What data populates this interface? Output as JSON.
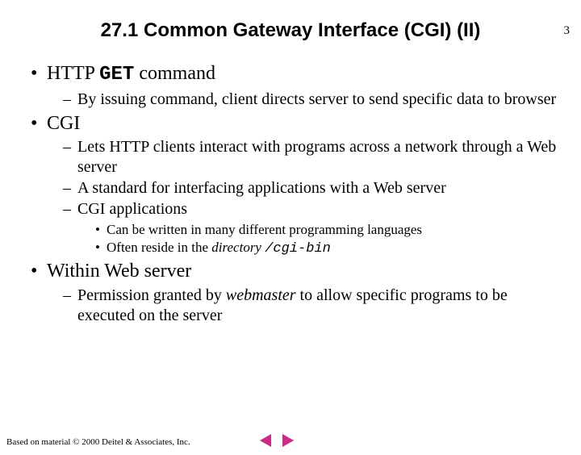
{
  "page_number": "3",
  "title": "27.1 Common Gateway Interface (CGI) (II)",
  "bullets": [
    {
      "prefix": "HTTP ",
      "mono": "GET",
      "suffix": " command",
      "sub": [
        {
          "text": "By issuing command, client directs server to send specific data to browser"
        }
      ]
    },
    {
      "text": "CGI",
      "sub": [
        {
          "text": "Lets HTTP clients interact with programs across a network through a Web server"
        },
        {
          "text": "A standard for interfacing applications with a Web server"
        },
        {
          "text": "CGI applications",
          "sub": [
            {
              "text": "Can be written in many different programming languages"
            },
            {
              "prefix": "Often reside in the ",
              "italic": "directory ",
              "mono_italic": "/cgi-bin"
            }
          ]
        }
      ]
    },
    {
      "text": "Within Web server",
      "sub": [
        {
          "prefix": "Permission granted by ",
          "italic": "webmaster",
          "suffix": " to allow specific programs to be executed on the server"
        }
      ]
    }
  ],
  "footer": "Based on material © 2000 Deitel & Associates, Inc."
}
